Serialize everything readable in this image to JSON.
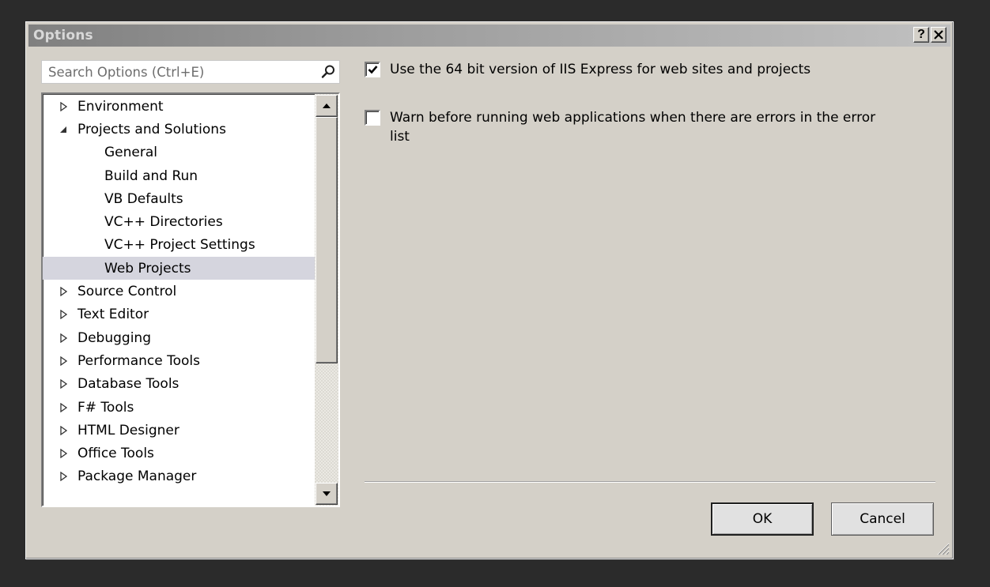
{
  "window": {
    "title": "Options",
    "help_label": "?",
    "close_label": "✕"
  },
  "search": {
    "placeholder": "Search Options (Ctrl+E)"
  },
  "tree": {
    "items": [
      {
        "label": "Environment",
        "state": "collapsed"
      },
      {
        "label": "Projects and Solutions",
        "state": "expanded"
      },
      {
        "label": "General",
        "state": "child"
      },
      {
        "label": "Build and Run",
        "state": "child"
      },
      {
        "label": "VB Defaults",
        "state": "child"
      },
      {
        "label": "VC++ Directories",
        "state": "child"
      },
      {
        "label": "VC++ Project Settings",
        "state": "child"
      },
      {
        "label": "Web Projects",
        "state": "child-selected"
      },
      {
        "label": "Source Control",
        "state": "collapsed"
      },
      {
        "label": "Text Editor",
        "state": "collapsed"
      },
      {
        "label": "Debugging",
        "state": "collapsed"
      },
      {
        "label": "Performance Tools",
        "state": "collapsed"
      },
      {
        "label": "Database Tools",
        "state": "collapsed"
      },
      {
        "label": "F# Tools",
        "state": "collapsed"
      },
      {
        "label": "HTML Designer",
        "state": "collapsed"
      },
      {
        "label": "Office Tools",
        "state": "collapsed"
      },
      {
        "label": "Package Manager",
        "state": "collapsed"
      }
    ]
  },
  "options": {
    "use_64bit": {
      "label": "Use the 64 bit version of IIS Express for web sites and projects",
      "checked": true
    },
    "warn_errors": {
      "label": "Warn before running web applications when there are errors in the error list",
      "checked": false
    }
  },
  "buttons": {
    "ok": "OK",
    "cancel": "Cancel"
  },
  "colors": {
    "dialog_bg": "#d4d0c8",
    "selection_bg": "#d5d5de",
    "title_text": "#d8d8d8"
  }
}
